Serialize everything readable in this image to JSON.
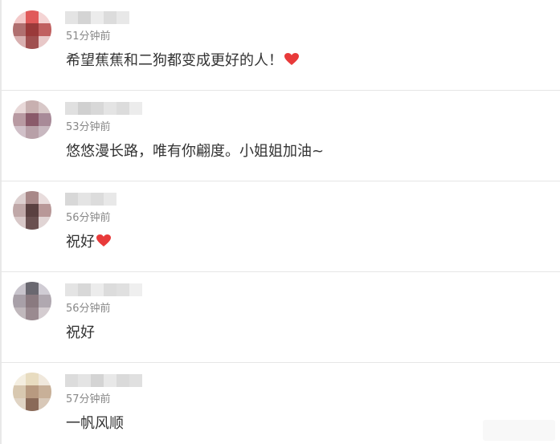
{
  "colors": {
    "heart": "#e83a3a",
    "time_text": "#888888",
    "comment_text": "#333333",
    "divider": "#e6e6e6"
  },
  "comments": [
    {
      "time": "51分钟前",
      "text": "希望蕉蕉和二狗都变成更好的人！",
      "heart": true
    },
    {
      "time": "53分钟前",
      "text": "悠悠漫长路，唯有你翩度。小姐姐加油~",
      "heart": false
    },
    {
      "time": "56分钟前",
      "text": "祝好",
      "heart": true
    },
    {
      "time": "56分钟前",
      "text": "祝好",
      "heart": false
    },
    {
      "time": "57分钟前",
      "text": "一帆风顺",
      "heart": false
    }
  ]
}
